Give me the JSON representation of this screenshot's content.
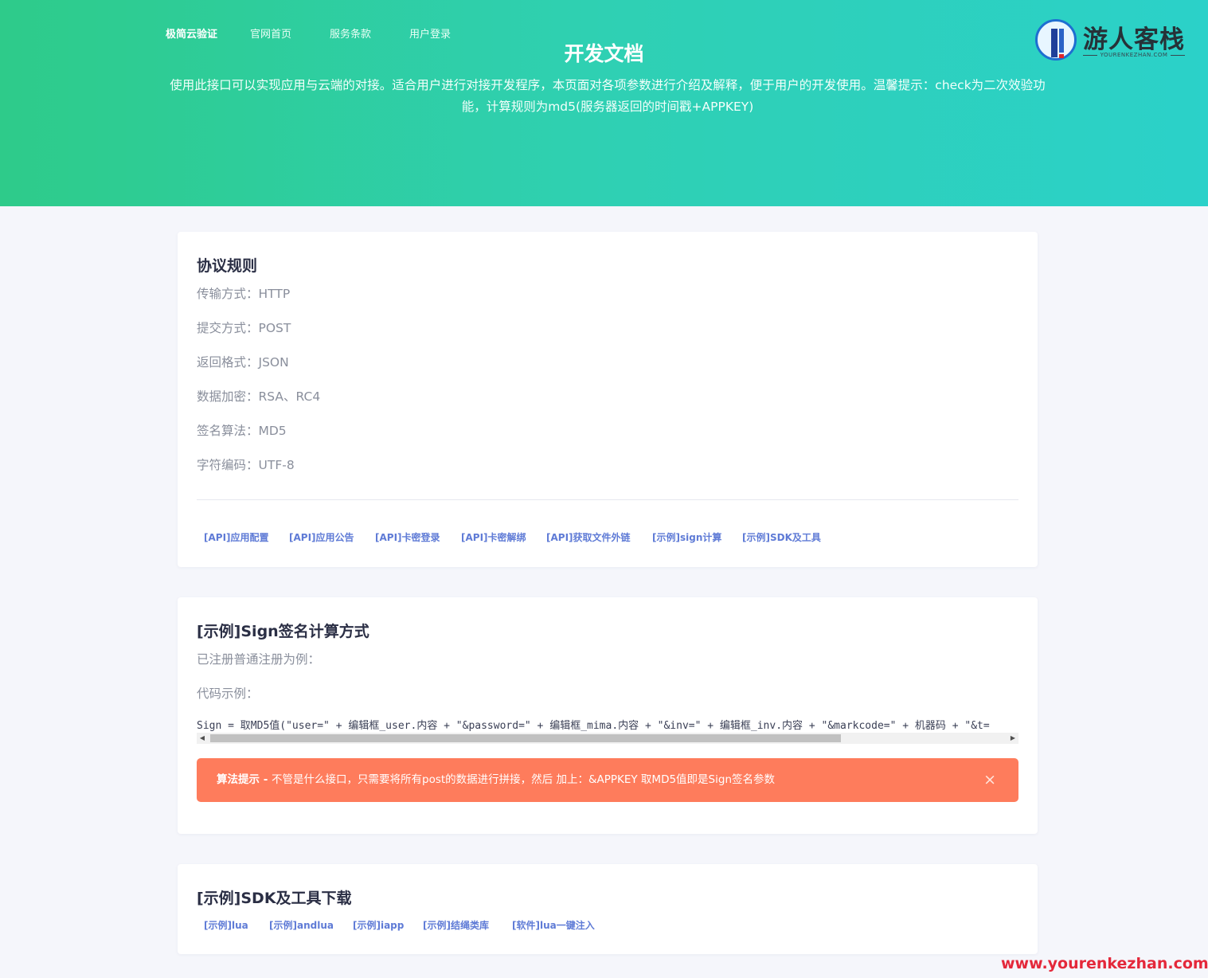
{
  "nav": {
    "brand": "极简云验证",
    "items": [
      "官网首页",
      "服务条款",
      "用户登录"
    ]
  },
  "hero": {
    "title": "开发文档",
    "description": "使用此接口可以实现应用与云端的对接。适合用户进行对接开发程序，本页面对各项参数进行介绍及解释，便于用户的开发使用。温馨提示：check为二次效验功能，计算规则为md5(服务器返回的时间戳+APPKEY)"
  },
  "logo": {
    "text": "游人客栈",
    "subtitle": "YOURENKEZHAN.COM"
  },
  "protocol": {
    "title": "协议规则",
    "rules": [
      "传输方式：HTTP",
      "提交方式：POST",
      "返回格式：JSON",
      "数据加密：RSA、RC4",
      "签名算法：MD5",
      "字符编码：UTF-8"
    ],
    "links": [
      "[API]应用配置",
      "[API]应用公告",
      "[API]卡密登录",
      "[API]卡密解绑",
      "[API]获取文件外链",
      "[示例]sign计算",
      "[示例]SDK及工具"
    ]
  },
  "sign": {
    "title": "[示例]Sign签名计算方式",
    "intro": "已注册普通注册为例：",
    "code_label": "代码示例：",
    "code": "Sign = 取MD5值(\"user=\" + 编辑框_user.内容 + \"&password=\" + 编辑框_mima.内容 + \"&inv=\" + 编辑框_inv.内容 + \"&markcode=\" + 机器码 + \"&t=",
    "alert_strong": "算法提示 - ",
    "alert_text": "不管是什么接口，只需要将所有post的数据进行拼接，然后 加上：&APPKEY 取MD5值即是Sign签名参数",
    "alert_close": "×"
  },
  "sdk": {
    "title": "[示例]SDK及工具下载",
    "links": [
      "[示例]lua",
      "[示例]andlua",
      "[示例]iapp",
      "[示例]结绳类库",
      "[软件]lua一键注入"
    ]
  },
  "watermark": "www.yourenkezhan.com",
  "colors": {
    "hero_start": "#2ecb8a",
    "hero_end": "#2bd1c9",
    "link": "#5f7bd6",
    "alert": "#fe7c5c",
    "heading": "#2b2f45"
  }
}
